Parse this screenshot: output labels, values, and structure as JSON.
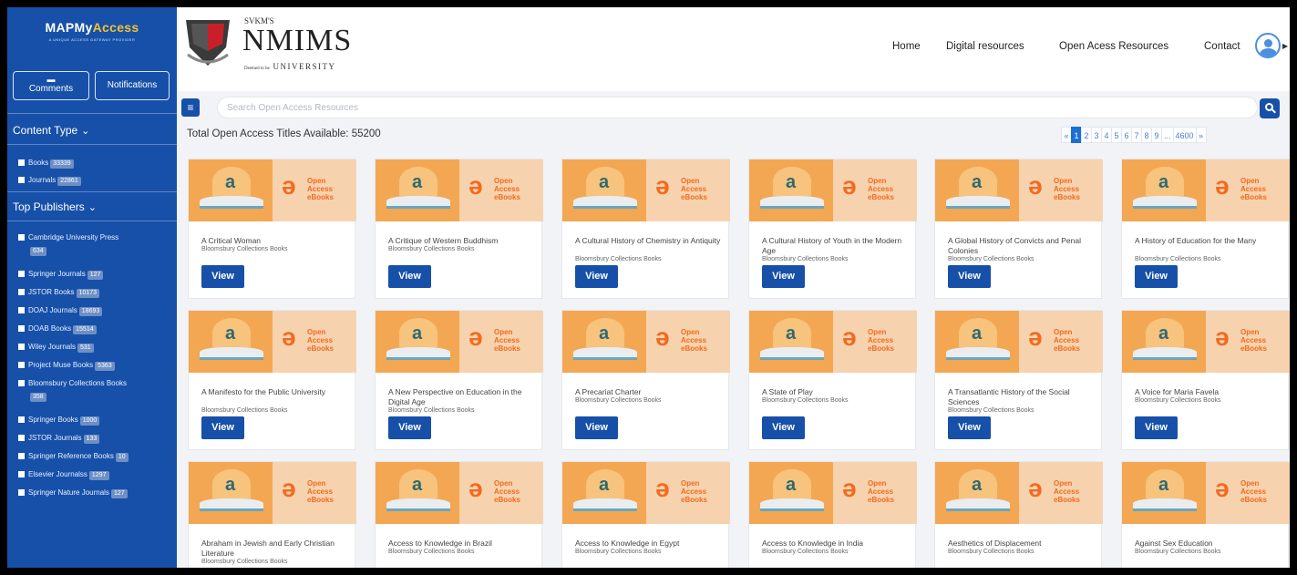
{
  "sidebar": {
    "brand_a": "MAPMy",
    "brand_b": "Access",
    "tagline": "A UNIQUE ACCESS GATEWAY PROVIDER",
    "comments_label": "Comments",
    "notifications_label": "Notifications",
    "content_type_heading": "Content Type",
    "content_types": [
      {
        "label": "Books",
        "count": "33339"
      },
      {
        "label": "Journals",
        "count": "22861"
      }
    ],
    "publishers_heading": "Top Publishers",
    "publishers": [
      {
        "label": "Cambridge University Press",
        "count": "634"
      },
      {
        "label": "Springer Journals",
        "count": "127"
      },
      {
        "label": "JSTOR Books",
        "count": "10173"
      },
      {
        "label": "DOAJ Journals",
        "count": "18693"
      },
      {
        "label": "DOAB Books",
        "count": "15514"
      },
      {
        "label": "Wiley Journals",
        "count": "531"
      },
      {
        "label": "Project Muse Books",
        "count": "5363"
      },
      {
        "label": "Bloomsbury Collections Books",
        "count": "358"
      },
      {
        "label": "Springer Books",
        "count": "1000"
      },
      {
        "label": "JSTOR Journals",
        "count": "133"
      },
      {
        "label": "Springer Reference Books",
        "count": "10"
      },
      {
        "label": "Elsevier Journalss",
        "count": "1297"
      },
      {
        "label": "Springer Nature Journals",
        "count": "127"
      }
    ]
  },
  "header": {
    "logo_top": "SVKM'S",
    "logo_main": "NMIMS",
    "logo_bottom_small": "Deemed to be",
    "logo_bottom": "UNIVERSITY",
    "nav": [
      "Home",
      "Digital resources",
      "Open Acess Resources",
      "Contact"
    ]
  },
  "search": {
    "placeholder": "Search Open Access Resources"
  },
  "total_label": "Total Open Access Titles Available: 55200",
  "pagination": [
    "«",
    "1",
    "2",
    "3",
    "4",
    "5",
    "6",
    "7",
    "8",
    "9",
    "...",
    "4600",
    "»"
  ],
  "thumb": {
    "oa_symbol": "a",
    "oa_line1": "Open",
    "oa_line2": "Access",
    "oa_line3": "eBooks"
  },
  "view_label": "View",
  "cards": [
    {
      "title": "A Critical Woman",
      "publisher": "Bloomsbury Collections Books"
    },
    {
      "title": "A Critique of Western Buddhism",
      "publisher": "Bloomsbury Collections Books"
    },
    {
      "title": "A Cultural History of Chemistry in Antiquity",
      "publisher": "Bloomsbury Collections Books"
    },
    {
      "title": "A Cultural History of Youth in the Modern Age",
      "publisher": "Bloomsbury Collections Books"
    },
    {
      "title": "A Global History of Convicts and Penal Colonies",
      "publisher": "Bloomsbury Collections Books"
    },
    {
      "title": "A History of Education for the Many",
      "publisher": "Bloomsbury Collections Books"
    },
    {
      "title": "A Manifesto for the Public University",
      "publisher": "Bloomsbury Collections Books"
    },
    {
      "title": "A New Perspective on Education in the Digital Age",
      "publisher": "Bloomsbury Collections Books"
    },
    {
      "title": "A Precariat Charter",
      "publisher": "Bloomsbury Collections Books"
    },
    {
      "title": "A State of Play",
      "publisher": "Bloomsbury Collections Books"
    },
    {
      "title": "A Transatlantic History of the Social Sciences",
      "publisher": "Bloomsbury Collections Books"
    },
    {
      "title": "A Voice for Maria Favela",
      "publisher": "Bloomsbury Collections Books"
    },
    {
      "title": "Abraham in Jewish and Early Christian Literature",
      "publisher": "Bloomsbury Collections Books"
    },
    {
      "title": "Access to Knowledge in Brazil",
      "publisher": "Bloomsbury Collections Books"
    },
    {
      "title": "Access to Knowledge in Egypt",
      "publisher": "Bloomsbury Collections Books"
    },
    {
      "title": "Access to Knowledge in India",
      "publisher": "Bloomsbury Collections Books"
    },
    {
      "title": "Aesthetics of Displacement",
      "publisher": "Bloomsbury Collections Books"
    },
    {
      "title": "Against Sex Education",
      "publisher": "Bloomsbury Collections Books"
    }
  ],
  "colors": {
    "sidebar": "#1750a8",
    "accent": "#1750a8",
    "oa_orange": "#f26b21"
  }
}
